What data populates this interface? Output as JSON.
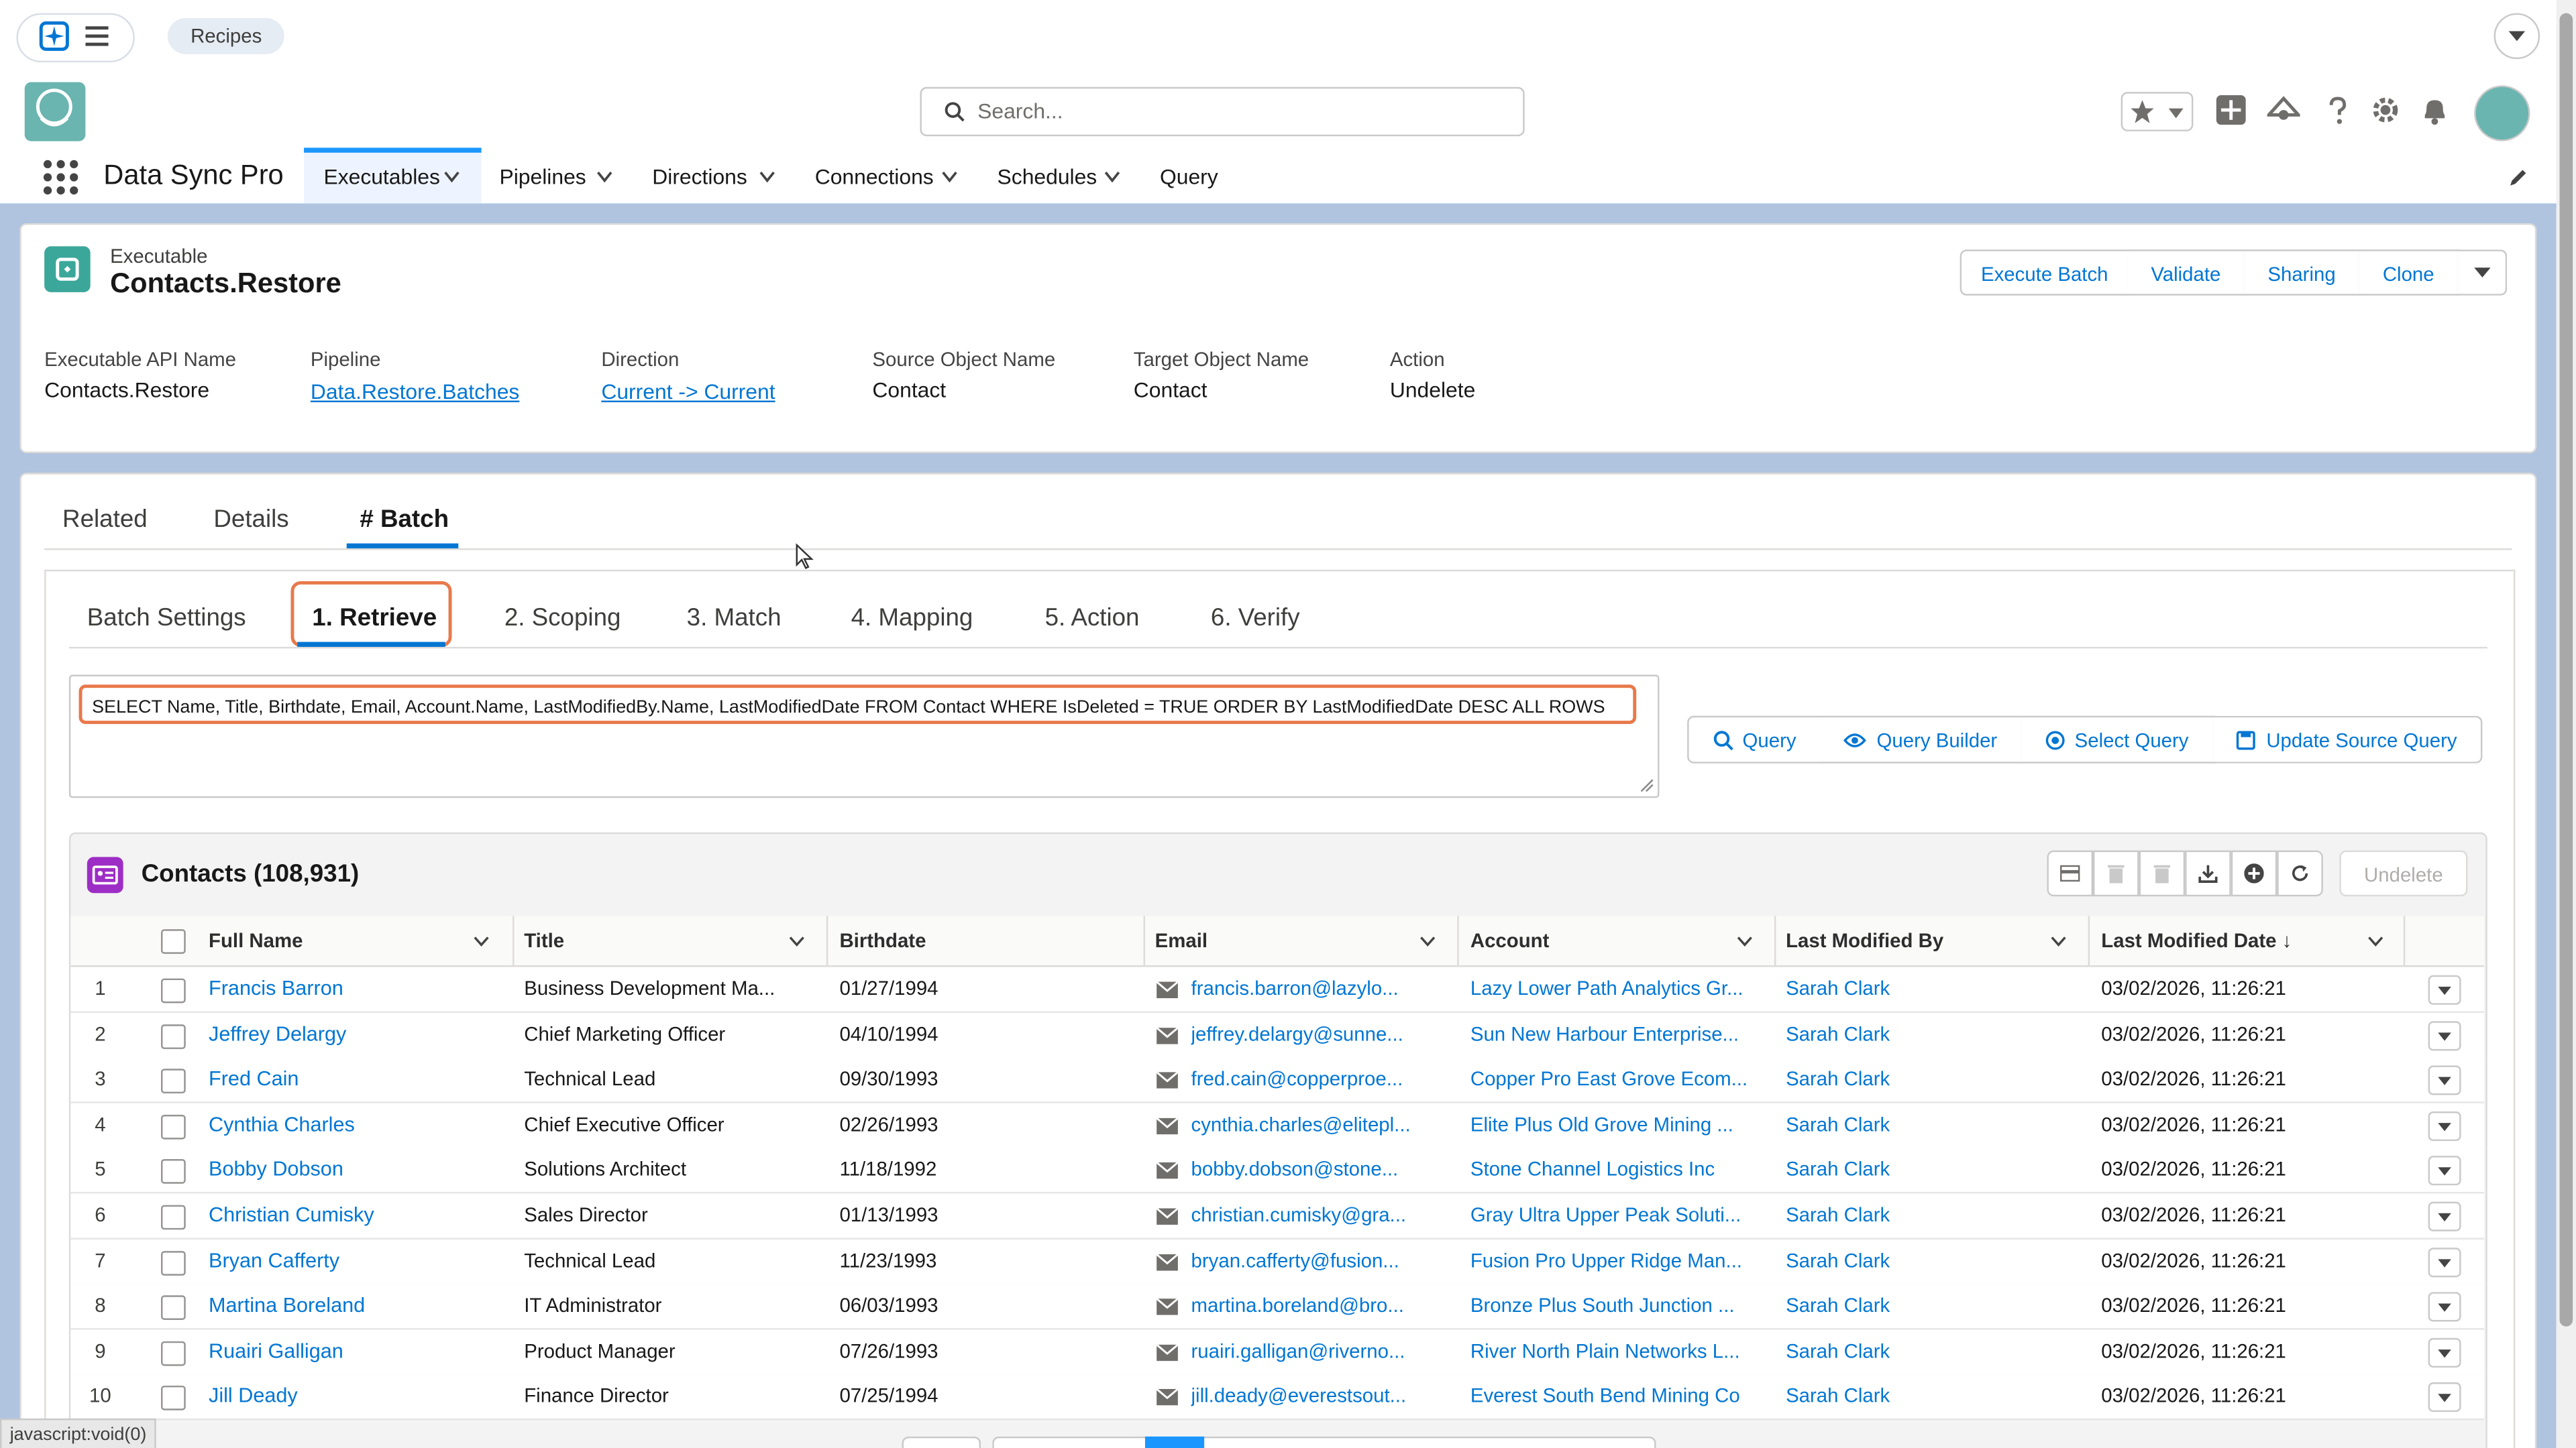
{
  "header": {
    "recipes_label": "Recipes",
    "search_placeholder": "Search...",
    "app_name": "Data Sync Pro"
  },
  "nav": {
    "tabs": [
      {
        "label": "Executables",
        "has_menu": true,
        "active": true
      },
      {
        "label": "Pipelines",
        "has_menu": true
      },
      {
        "label": "Directions",
        "has_menu": true
      },
      {
        "label": "Connections",
        "has_menu": true
      },
      {
        "label": "Schedules",
        "has_menu": true
      },
      {
        "label": "Query",
        "has_menu": false
      }
    ]
  },
  "record": {
    "object_label": "Executable",
    "title": "Contacts.Restore",
    "actions": [
      "Execute Batch",
      "Validate",
      "Sharing",
      "Clone"
    ],
    "fields": [
      {
        "label": "Executable API Name",
        "value": "Contacts.Restore",
        "link": false
      },
      {
        "label": "Pipeline",
        "value": "Data.Restore.Batches",
        "link": true
      },
      {
        "label": "Direction",
        "value": "Current -> Current",
        "link": true
      },
      {
        "label": "Source Object Name",
        "value": "Contact",
        "link": false
      },
      {
        "label": "Target Object Name",
        "value": "Contact",
        "link": false
      },
      {
        "label": "Action",
        "value": "Undelete",
        "link": false
      }
    ]
  },
  "tabs": {
    "main": [
      "Related",
      "Details",
      "# Batch"
    ],
    "active_main": "# Batch",
    "sub": [
      "Batch Settings",
      "1. Retrieve",
      "2. Scoping",
      "3. Match",
      "4. Mapping",
      "5. Action",
      "6. Verify"
    ],
    "active_sub": "1. Retrieve"
  },
  "query": {
    "text": "SELECT Name, Title, Birthdate, Email, Account.Name, LastModifiedBy.Name, LastModifiedDate FROM Contact WHERE IsDeleted = TRUE ORDER BY LastModifiedDate DESC ALL ROWS",
    "buttons": [
      "Query",
      "Query Builder",
      "Select Query",
      "Update Source Query"
    ]
  },
  "table": {
    "title": "Contacts (108,931)",
    "undelete_label": "Undelete",
    "columns": [
      "Full Name",
      "Title",
      "Birthdate",
      "Email",
      "Account",
      "Last Modified By",
      "Last Modified Date ↓"
    ],
    "rows": [
      {
        "n": "1",
        "name": "Francis Barron",
        "title": "Business Development Ma...",
        "birthdate": "01/27/1994",
        "email": "francis.barron@lazylo...",
        "account": "Lazy Lower Path Analytics Gr...",
        "modified_by": "Sarah Clark",
        "modified_date": "03/02/2026, 11:26:21"
      },
      {
        "n": "2",
        "name": "Jeffrey Delargy",
        "title": "Chief Marketing Officer",
        "birthdate": "04/10/1994",
        "email": "jeffrey.delargy@sunne...",
        "account": "Sun New Harbour Enterprise...",
        "modified_by": "Sarah Clark",
        "modified_date": "03/02/2026, 11:26:21"
      },
      {
        "n": "3",
        "name": "Fred Cain",
        "title": "Technical Lead",
        "birthdate": "09/30/1993",
        "email": "fred.cain@copperproe...",
        "account": "Copper Pro East Grove Ecom...",
        "modified_by": "Sarah Clark",
        "modified_date": "03/02/2026, 11:26:21"
      },
      {
        "n": "4",
        "name": "Cynthia Charles",
        "title": "Chief Executive Officer",
        "birthdate": "02/26/1993",
        "email": "cynthia.charles@elitepl...",
        "account": "Elite Plus Old Grove Mining ...",
        "modified_by": "Sarah Clark",
        "modified_date": "03/02/2026, 11:26:21"
      },
      {
        "n": "5",
        "name": "Bobby Dobson",
        "title": "Solutions Architect",
        "birthdate": "11/18/1992",
        "email": "bobby.dobson@stone...",
        "account": "Stone Channel Logistics Inc",
        "modified_by": "Sarah Clark",
        "modified_date": "03/02/2026, 11:26:21"
      },
      {
        "n": "6",
        "name": "Christian Cumisky",
        "title": "Sales Director",
        "birthdate": "01/13/1993",
        "email": "christian.cumisky@gra...",
        "account": "Gray Ultra Upper Peak Soluti...",
        "modified_by": "Sarah Clark",
        "modified_date": "03/02/2026, 11:26:21"
      },
      {
        "n": "7",
        "name": "Bryan Cafferty",
        "title": "Technical Lead",
        "birthdate": "11/23/1993",
        "email": "bryan.cafferty@fusion...",
        "account": "Fusion Pro Upper Ridge Man...",
        "modified_by": "Sarah Clark",
        "modified_date": "03/02/2026, 11:26:21"
      },
      {
        "n": "8",
        "name": "Martina Boreland",
        "title": "IT Administrator",
        "birthdate": "06/03/1993",
        "email": "martina.boreland@bro...",
        "account": "Bronze Plus South Junction ...",
        "modified_by": "Sarah Clark",
        "modified_date": "03/02/2026, 11:26:21"
      },
      {
        "n": "9",
        "name": "Ruairi Galligan",
        "title": "Product Manager",
        "birthdate": "07/26/1993",
        "email": "ruairi.galligan@riverno...",
        "account": "River North Plain Networks L...",
        "modified_by": "Sarah Clark",
        "modified_date": "03/02/2026, 11:26:21"
      },
      {
        "n": "10",
        "name": "Jill Deady",
        "title": "Finance Director",
        "birthdate": "07/25/1994",
        "email": "jill.deady@everestsout...",
        "account": "Everest South Bend Mining Co",
        "modified_by": "Sarah Clark",
        "modified_date": "03/02/2026, 11:26:21"
      }
    ]
  },
  "statusbar": {
    "text": "javascript:void(0)"
  },
  "colors": {
    "brand": "#0176d3",
    "accent_outline": "#e8794b",
    "page_bg": "#b0c4df",
    "purple_icon": "#9d2ec5"
  }
}
